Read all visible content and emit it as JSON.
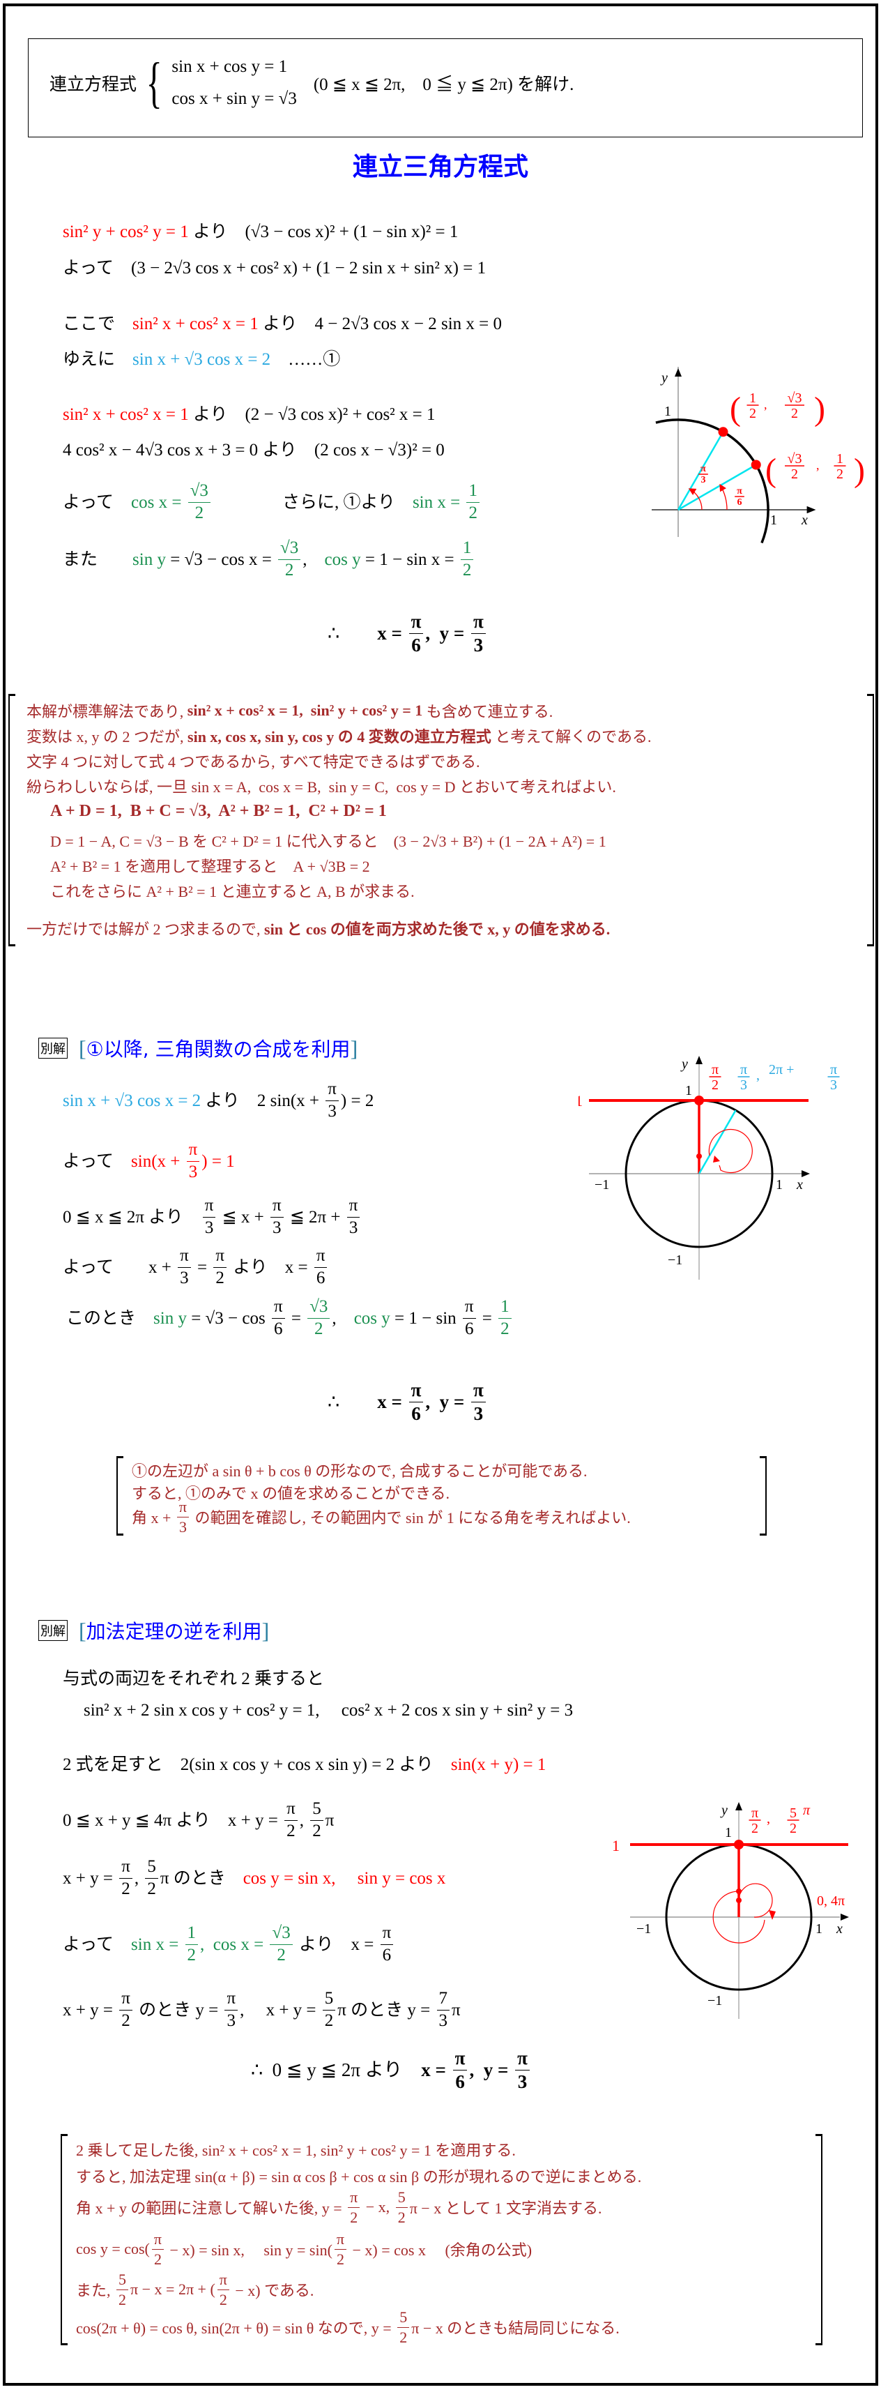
{
  "colors": {
    "red": "#ff0000",
    "cyan": "#29a8e0",
    "green": "#1a9050",
    "note": "#a52a2a",
    "blue": "#0000ff",
    "diagram_cyan": "#00e5ee",
    "axis_gray": "#888888"
  },
  "problem": {
    "label": "連立方程式",
    "eq1": "sin x + cos y = 1",
    "eq2": "cos x + sin y = √3",
    "range": "(0 ≦ x ≦ 2π,　0 ≦ y ≦ 2π) を解け."
  },
  "title": "連立三角方程式",
  "main": {
    "lines": [
      [
        {
          "t": "sin² y + cos² y = 1",
          "c": "red"
        },
        {
          "t": " より　(√3 − cos x)² + (1 − sin x)² = 1"
        }
      ],
      [
        {
          "t": "よって　(3 − 2√3 cos x + cos² x) + (1 − 2 sin x + sin² x) = 1"
        }
      ],
      [
        {
          "t": "ここで　"
        },
        {
          "t": "sin² x + cos² x = 1",
          "c": "red"
        },
        {
          "t": " より　4 − 2√3 cos x − 2 sin x = 0"
        }
      ],
      [
        {
          "t": "ゆえに　"
        },
        {
          "t": "sin x + √3 cos x = 2",
          "c": "cyan"
        },
        {
          "t": "　……①"
        }
      ],
      [
        {
          "t": "sin² x + cos² x = 1",
          "c": "red"
        },
        {
          "t": " より　(2 − √3 cos x)² + cos² x = 1"
        }
      ],
      [
        {
          "t": "4 cos² x − 4√3 cos x + 3 = 0 より　(2 cos x − √3)² = 0"
        }
      ],
      [
        {
          "t": "よって　"
        },
        {
          "t": "cos x = ",
          "c": "green"
        },
        {
          "f": [
            "√3",
            "2"
          ],
          "c": "green"
        },
        {
          "t": "　　　　さらに, ①より　"
        },
        {
          "t": "sin x = ",
          "c": "green"
        },
        {
          "f": [
            "1",
            "2"
          ],
          "c": "green"
        }
      ],
      [
        {
          "t": "また　　"
        },
        {
          "t": "sin y",
          "c": "green"
        },
        {
          "t": " = √3 − cos x = "
        },
        {
          "f": [
            "√3",
            "2"
          ],
          "c": "green"
        },
        {
          "t": ",　"
        },
        {
          "t": "cos y",
          "c": "green"
        },
        {
          "t": " = 1 − sin x = "
        },
        {
          "f": [
            "1",
            "2"
          ],
          "c": "green"
        }
      ],
      [
        {
          "t": "∴　　"
        },
        {
          "t": "x = ",
          "b": true
        },
        {
          "f": [
            "π",
            "6"
          ],
          "b": true
        },
        {
          "t": ",  y = ",
          "b": true
        },
        {
          "f": [
            "π",
            "3"
          ],
          "b": true
        }
      ]
    ],
    "diagram": {
      "axis_x": "x",
      "axis_y": "y",
      "tick_1_x": "1",
      "tick_1_y": "1",
      "point_a": "(1/2, √3/2)",
      "point_b": "(√3/2, 1/2)",
      "point_a_num": [
        "1",
        "2"
      ],
      "point_a_num2": [
        "√3",
        "2"
      ],
      "point_b_num": [
        "√3",
        "2"
      ],
      "point_b_num2": [
        "1",
        "2"
      ],
      "angle_a": [
        "π",
        "3"
      ],
      "angle_b": [
        "π",
        "6"
      ]
    }
  },
  "note1": {
    "lines": [
      [
        {
          "t": "本解が標準解法であり, "
        },
        {
          "t": "sin² x + cos² x = 1,  sin² y + cos² y = 1",
          "b": true
        },
        {
          "t": " も含めて連立する."
        }
      ],
      [
        {
          "t": "変数は x, y の 2 つだが, "
        },
        {
          "t": "sin x, cos x, sin y, cos y の 4 変数の連立方程式",
          "b": true
        },
        {
          "t": " と考えて解くのである."
        }
      ],
      [
        {
          "t": "文字 4 つに対して式 4 つであるから, すべて特定できるはずである."
        }
      ],
      [
        {
          "t": "紛らわしいならば, 一旦 sin x = A,  cos x = B,  sin y = C,  cos y = D とおいて考えればよい."
        }
      ],
      [
        {
          "t": "A + D = 1,  B + C = √3,  A² + B² = 1,  C² + D² = 1",
          "b": true
        }
      ],
      [
        {
          "t": "D = 1 − A, C = √3 − B を C² + D² = 1 に代入すると　(3 − 2√3 + B²) + (1 − 2A + A²) = 1"
        }
      ],
      [
        {
          "t": "A² + B² = 1 を適用して整理すると　A + √3B = 2"
        }
      ],
      [
        {
          "t": "これをさらに A² + B² = 1 と連立すると A, B が求まる."
        }
      ],
      [
        {
          "t": "一方だけでは解が 2 つ求まるので, "
        },
        {
          "t": "sin と cos の値を両方求めた後で x, y の値を求める.",
          "b": true
        }
      ]
    ]
  },
  "alt1": {
    "badge": "別解",
    "heading": "①以降, 三角関数の合成を利用",
    "lines": [
      [
        {
          "t": "sin x + √3 cos x = 2",
          "c": "cyan"
        },
        {
          "t": " より　2 sin(x + "
        },
        {
          "f": [
            "π",
            "3"
          ]
        },
        {
          "t": ") = 2"
        }
      ],
      [
        {
          "t": "よって　"
        },
        {
          "t": "sin(x + ",
          "c": "red"
        },
        {
          "f": [
            "π",
            "3"
          ],
          "c": "red"
        },
        {
          "t": ") = 1",
          "c": "red"
        }
      ],
      [
        {
          "t": "0 ≦ x ≦ 2π より　"
        },
        {
          "f": [
            "π",
            "3"
          ]
        },
        {
          "t": " ≦ x + "
        },
        {
          "f": [
            "π",
            "3"
          ]
        },
        {
          "t": " ≦ 2π + "
        },
        {
          "f": [
            "π",
            "3"
          ]
        }
      ],
      [
        {
          "t": "よって　　x + "
        },
        {
          "f": [
            "π",
            "3"
          ]
        },
        {
          "t": " = "
        },
        {
          "f": [
            "π",
            "2"
          ]
        },
        {
          "t": " より　x = "
        },
        {
          "f": [
            "π",
            "6"
          ]
        }
      ],
      [
        {
          "t": "このとき　"
        },
        {
          "t": "sin y",
          "c": "green"
        },
        {
          "t": " = √3 − cos "
        },
        {
          "f": [
            "π",
            "6"
          ]
        },
        {
          "t": " = "
        },
        {
          "f": [
            "√3",
            "2"
          ],
          "c": "green"
        },
        {
          "t": ",　"
        },
        {
          "t": "cos y",
          "c": "green"
        },
        {
          "t": " = 1 − sin "
        },
        {
          "f": [
            "π",
            "6"
          ]
        },
        {
          "t": " = "
        },
        {
          "f": [
            "1",
            "2"
          ],
          "c": "green"
        }
      ],
      [
        {
          "t": "∴　　"
        },
        {
          "t": "x = ",
          "b": true
        },
        {
          "f": [
            "π",
            "6"
          ],
          "b": true
        },
        {
          "t": ",  y = ",
          "b": true
        },
        {
          "f": [
            "π",
            "3"
          ],
          "b": true
        }
      ]
    ],
    "diagram": {
      "axis_x": "x",
      "axis_y": "y",
      "tick_1": "1",
      "tick_m1": "−1",
      "line_label": "1",
      "label_red": [
        "π",
        "2"
      ],
      "label_cyan_a": [
        "π",
        "3"
      ],
      "label_cyan_b_prefix": "2π +",
      "label_cyan_b": [
        "π",
        "3"
      ]
    }
  },
  "note2": {
    "lines": [
      [
        {
          "t": "①の左辺が a sin θ + b cos θ の形なので, 合成することが可能である."
        }
      ],
      [
        {
          "t": "すると, ①のみで x の値を求めることができる."
        }
      ],
      [
        {
          "t": "角 x + "
        },
        {
          "f": [
            "π",
            "3"
          ]
        },
        {
          "t": " の範囲を確認し, その範囲内で sin が 1 になる角を考えればよい."
        }
      ]
    ]
  },
  "alt2": {
    "badge": "別解",
    "heading": "加法定理の逆を利用",
    "lines": [
      [
        {
          "t": "与式の両辺をそれぞれ 2 乗すると"
        }
      ],
      [
        {
          "t": "sin² x + 2 sin x cos y + cos² y = 1,　 cos² x + 2 cos x sin y + sin² y = 3"
        }
      ],
      [
        {
          "t": "2 式を足すと　2(sin x cos y + cos x sin y) = 2 より　"
        },
        {
          "t": "sin(x + y) = 1",
          "c": "red"
        }
      ],
      [
        {
          "t": "0 ≦ x + y ≦ 4π より　x + y = "
        },
        {
          "f": [
            "π",
            "2"
          ]
        },
        {
          "t": ", "
        },
        {
          "f": [
            "5",
            "2"
          ]
        },
        {
          "t": "π"
        }
      ],
      [
        {
          "t": "x + y = "
        },
        {
          "f": [
            "π",
            "2"
          ]
        },
        {
          "t": ", "
        },
        {
          "f": [
            "5",
            "2"
          ]
        },
        {
          "t": "π のとき　"
        },
        {
          "t": "cos y = sin x,　 sin y = cos x",
          "c": "red"
        }
      ],
      [
        {
          "t": "よって　"
        },
        {
          "t": "sin x = ",
          "c": "green"
        },
        {
          "f": [
            "1",
            "2"
          ],
          "c": "green"
        },
        {
          "t": ",  ",
          "c": "green"
        },
        {
          "t": "cos x = ",
          "c": "green"
        },
        {
          "f": [
            "√3",
            "2"
          ],
          "c": "green"
        },
        {
          "t": " より　x = "
        },
        {
          "f": [
            "π",
            "6"
          ]
        }
      ],
      [
        {
          "t": "x + y = "
        },
        {
          "f": [
            "π",
            "2"
          ]
        },
        {
          "t": " のとき y = "
        },
        {
          "f": [
            "π",
            "3"
          ]
        },
        {
          "t": ",　 x + y = "
        },
        {
          "f": [
            "5",
            "2"
          ]
        },
        {
          "t": "π のとき y = "
        },
        {
          "f": [
            "7",
            "3"
          ]
        },
        {
          "t": "π"
        }
      ],
      [
        {
          "t": "∴  0 ≦ y ≦ 2π より　"
        },
        {
          "t": "x = ",
          "b": true
        },
        {
          "f": [
            "π",
            "6"
          ],
          "b": true
        },
        {
          "t": ",  y = ",
          "b": true
        },
        {
          "f": [
            "π",
            "3"
          ],
          "b": true
        }
      ]
    ],
    "diagram": {
      "axis_x": "x",
      "axis_y": "y",
      "tick_1": "1",
      "tick_m1": "−1",
      "line_label": "1",
      "label_a": [
        "π",
        "2"
      ],
      "label_b": [
        "5",
        "2"
      ],
      "label_b_suffix": "π",
      "start_label": "0,  4π"
    }
  },
  "note3": {
    "lines": [
      [
        {
          "t": "2 乗して足した後, sin² x + cos² x = 1, sin² y + cos² y = 1 を適用する."
        }
      ],
      [
        {
          "t": "すると, 加法定理 sin(α + β) = sin α cos β + cos α sin β の形が現れるので逆にまとめる."
        }
      ],
      [
        {
          "t": "角 x + y の範囲に注意して解いた後, y = "
        },
        {
          "f": [
            "π",
            "2"
          ]
        },
        {
          "t": " − x, "
        },
        {
          "f": [
            "5",
            "2"
          ]
        },
        {
          "t": "π − x として 1 文字消去する."
        }
      ],
      [
        {
          "t": "cos y = cos("
        },
        {
          "f": [
            "π",
            "2"
          ]
        },
        {
          "t": " − x) = sin x,　 sin y = sin("
        },
        {
          "f": [
            "π",
            "2"
          ]
        },
        {
          "t": " − x) = cos x　 (余角の公式)"
        }
      ],
      [
        {
          "t": "また, "
        },
        {
          "f": [
            "5",
            "2"
          ]
        },
        {
          "t": "π − x = 2π + ("
        },
        {
          "f": [
            "π",
            "2"
          ]
        },
        {
          "t": " − x) である."
        }
      ],
      [
        {
          "t": "cos(2π + θ) = cos θ, sin(2π + θ) = sin θ なので, y = "
        },
        {
          "f": [
            "5",
            "2"
          ]
        },
        {
          "t": "π − x のときも結局同じになる."
        }
      ]
    ]
  }
}
